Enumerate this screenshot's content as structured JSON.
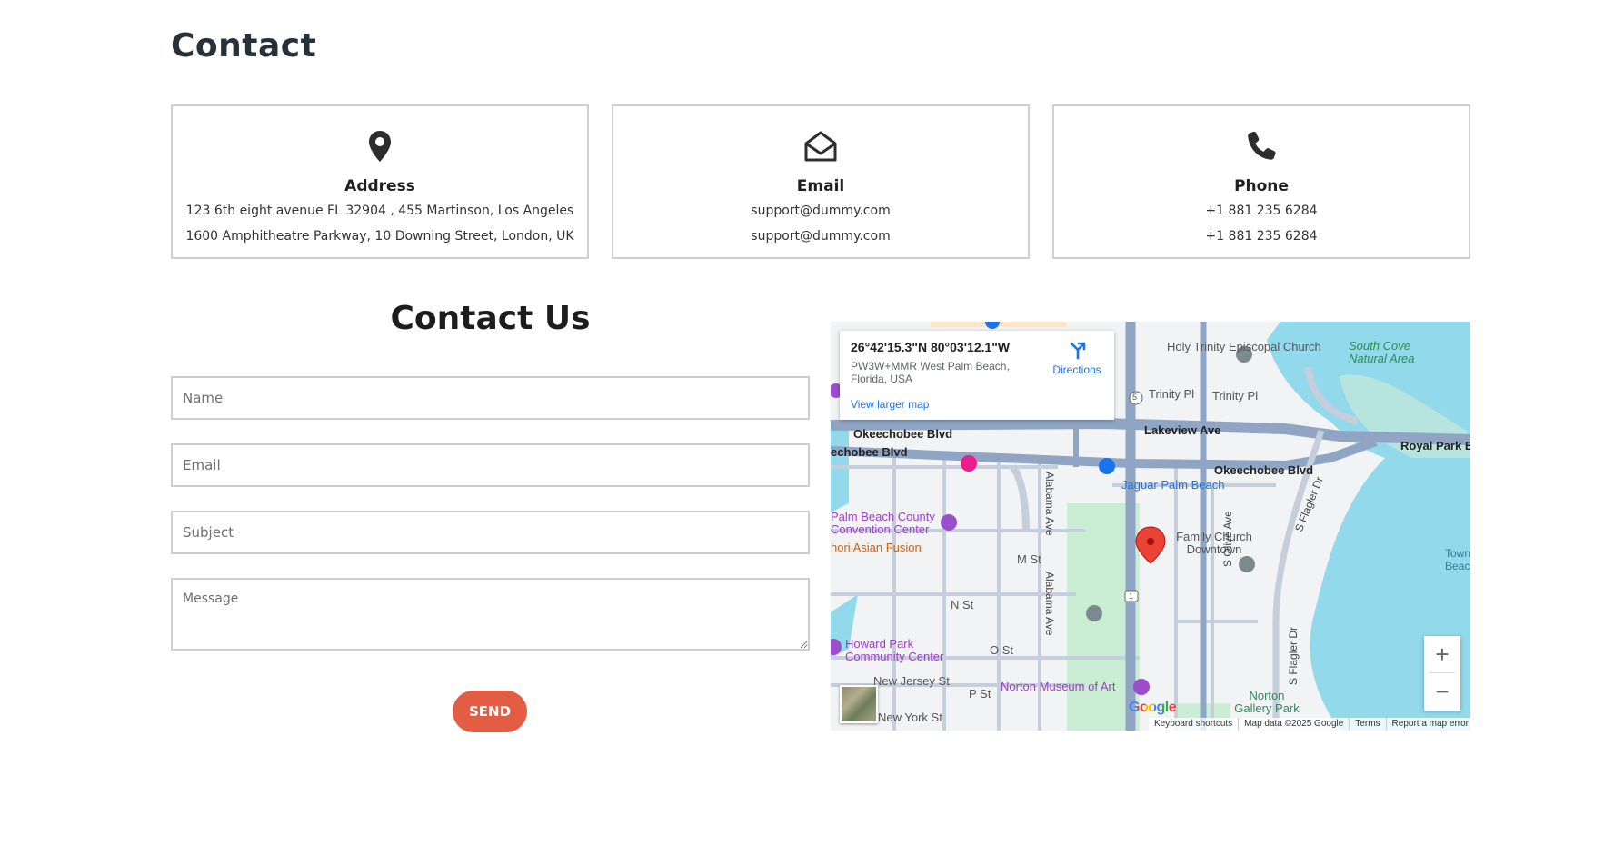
{
  "page": {
    "title": "Contact"
  },
  "cards": [
    {
      "icon": "map-pin-icon",
      "title": "Address",
      "line1": "123 6th eight avenue FL 32904 , 455 Martinson, Los Angeles",
      "line2": "1600 Amphitheatre Parkway, 10 Downing Street, London, UK"
    },
    {
      "icon": "envelope-open-icon",
      "title": "Email",
      "line1": "support@dummy.com",
      "line2": "support@dummy.com"
    },
    {
      "icon": "phone-icon",
      "title": "Phone",
      "line1": "+1 881 235 6284",
      "line2": "+1 881 235 6284"
    }
  ],
  "form": {
    "title": "Contact Us",
    "name_placeholder": "Name",
    "email_placeholder": "Email",
    "subject_placeholder": "Subject",
    "message_placeholder": "Message",
    "send_label": "SEND"
  },
  "map": {
    "info": {
      "coords": "26°42'15.3\"N 80°03'12.1\"W",
      "address": "PW3W+MMR West Palm Beach, Florida, USA",
      "view_larger": "View larger map",
      "directions": "Directions"
    },
    "labels": {
      "holy_trinity": "Holy Trinity Episcopal Church",
      "south_cove": "South Cove Natural Area",
      "trinity_pl": "Trinity Pl",
      "trinity_pl2": "Trinity Pl",
      "okeechobee1": "Okeechobee Blvd",
      "okeechobee2": "echobee Blvd",
      "okeechobee3": "Okeechobee Blvd",
      "lakeview": "Lakeview Ave",
      "royal_palm": "Royal Park B",
      "jaguar": "Jaguar Palm Beach",
      "convention": "Palm Beach County Convention Center",
      "asian_fusion": "hori Asian Fusion",
      "family_church": "Family Church Downtown",
      "m_st": "M St",
      "n_st": "N St",
      "o_st": "O St",
      "p_st": "P St",
      "new_jersey": "New Jersey St",
      "new_york": "New York St",
      "howard_park": "Howard Park Community Center",
      "norton_museum": "Norton Museum of Art",
      "norton_gallery": "Norton Gallery Park",
      "alabama1": "Alabama Ave",
      "alabama2": "Alabama Ave",
      "s_olive": "S Olive Ave",
      "s_flagler1": "S Flagler Dr",
      "s_flagler2": "S Flagler Dr",
      "town_beach": "Town Beac",
      "route5": "5",
      "route1": "1"
    },
    "google": "Google",
    "attribution": {
      "shortcuts": "Keyboard shortcuts",
      "data": "Map data ©2025 Google",
      "terms": "Terms",
      "report": "Report a map error"
    },
    "zoom_in": "+",
    "zoom_out": "−",
    "colors": {
      "water": "#92d9ec",
      "park": "#c9eed4",
      "road": "#8fa5c3",
      "pin": "#ea4335"
    }
  }
}
